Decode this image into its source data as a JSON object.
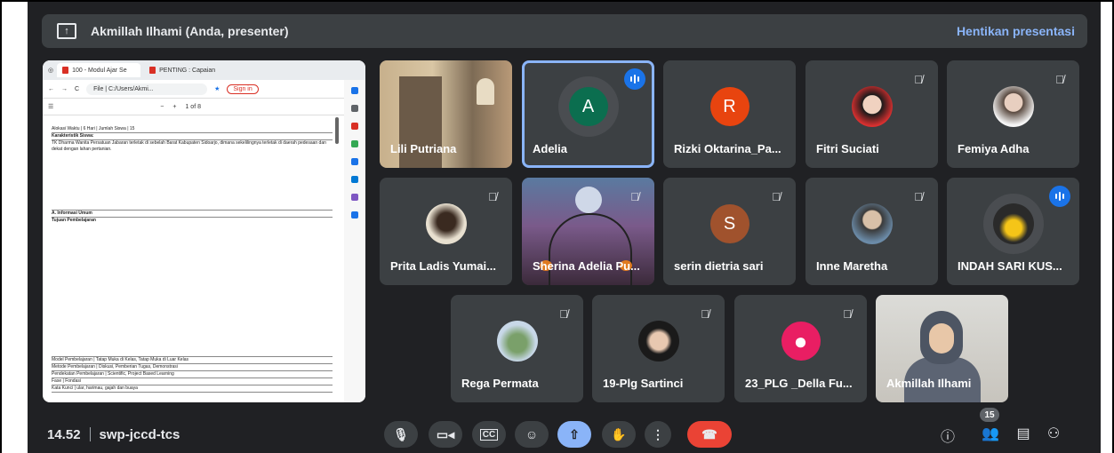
{
  "banner": {
    "presenter_label": "Akmillah Ilhami (Anda, presenter)",
    "stop_label": "Hentikan presentasi"
  },
  "shared_screen": {
    "tabs": [
      "100 - Modul Ajar Se",
      "PENTING : Capaian"
    ],
    "address": "File | C:/Users/Akmi...",
    "signin": "Sign in",
    "page_counter": "1 of 8",
    "doc_lines": [
      "Alokasi Waktu | 6 Hari | Jumlah Siswa | 15",
      "Karakteristik Siswa:",
      "TK Dharma Wanita Persatuan Jabaran terletak di sebelah Barat Kabupaten Sidoarjo, dimana sekelilingnya terletak di daerah pedesaan dan dekat dengan lahan pertanian.",
      "A. Informasi Umum",
      "Tujuan Pembelajaran",
      "Model Pembelajaran | Tatap Muka di Kelas, Tatap Muka di Luar Kelas",
      "Metode Pembelajaran | Diskusi, Pemberian Tugas, Demonstrasi",
      "Pendekatan Pembelajaran | Scientific, Project Based Learning",
      "Fase | Fondasi",
      "Kata Kunci | ular, harimau, gajah dan buaya"
    ]
  },
  "participants": [
    {
      "name": "Lili Putriana",
      "type": "photo"
    },
    {
      "name": "Adelia",
      "initial": "A",
      "avatar_color": "#0b6e4f",
      "speaking": true
    },
    {
      "name": "Rizki Oktarina_Pa...",
      "initial": "R",
      "avatar_color": "#e8440f"
    },
    {
      "name": "Fitri Suciati",
      "muted": true
    },
    {
      "name": "Femiya Adha",
      "muted": true
    },
    {
      "name": "Prita Ladis Yumai...",
      "muted": true
    },
    {
      "name": "Sherina Adelia Pu...",
      "muted": true
    },
    {
      "name": "serin dietria sari",
      "initial": "S",
      "avatar_color": "#a0522d",
      "muted": true
    },
    {
      "name": "Inne Maretha",
      "muted": true
    },
    {
      "name": "INDAH SARI KUS...",
      "speaking": true
    },
    {
      "name": "Rega Permata",
      "muted": true
    },
    {
      "name": "19-Plg Sartinci",
      "muted": true
    },
    {
      "name": "23_PLG _Della Fu...",
      "muted": true
    },
    {
      "name": "Akmillah Ilhami",
      "type": "self"
    }
  ],
  "footer": {
    "time": "14.52",
    "meeting_code": "swp-jccd-tcs",
    "people_count": "15"
  },
  "icons": {
    "mic": "microphone-icon",
    "camera": "camera-icon",
    "captions": "captions-icon",
    "emoji": "emoji-icon",
    "present": "present-icon",
    "hand": "raise-hand-icon",
    "more": "more-icon",
    "end": "end-call-icon",
    "info": "info-icon",
    "people": "people-icon",
    "chat": "chat-icon",
    "activities": "activities-icon"
  },
  "colors": {
    "background": "#202124",
    "tile": "#3c4043",
    "accent_blue": "#8ab4f8",
    "end_call": "#ea4335"
  }
}
